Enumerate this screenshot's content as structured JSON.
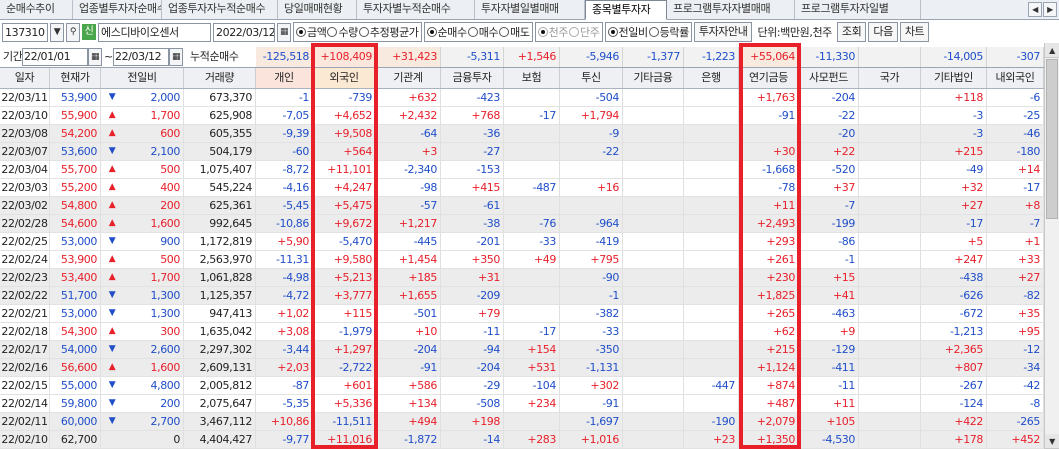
{
  "tabs": [
    {
      "label": "순매수추이"
    },
    {
      "label": "업종별투자자순매수"
    },
    {
      "label": "업종투자자누적순매수"
    },
    {
      "label": "당일매매현황"
    },
    {
      "label": "투자자별누적순매수"
    },
    {
      "label": "투자자별일별매매"
    },
    {
      "label": "종목별투자자"
    },
    {
      "label": "프로그램투자자별매매"
    },
    {
      "label": "프로그램투자자일별"
    }
  ],
  "active_tab": 6,
  "toolbar": {
    "code": "137310",
    "badge": "신",
    "stock_name": "에스디바이오센서",
    "date": "2022/03/12",
    "radio_value": [
      {
        "label": "금액",
        "on": true
      },
      {
        "label": "수량",
        "on": false
      },
      {
        "label": "추정평균가",
        "on": false
      }
    ],
    "radio_trade": [
      {
        "label": "순매수",
        "on": true
      },
      {
        "label": "매수",
        "on": false
      },
      {
        "label": "매도",
        "on": false
      }
    ],
    "radio_unit": [
      {
        "label": "천주",
        "on": true
      },
      {
        "label": "단주",
        "on": false
      }
    ],
    "radio_compare": [
      {
        "label": "전일비",
        "on": true
      },
      {
        "label": "등락률",
        "on": false
      }
    ],
    "info_button": "투자자안내",
    "unit_label": "단위:백만원,천주",
    "query_button": "조회",
    "next_button": "다음",
    "chart_button": "차트"
  },
  "period": {
    "label": "기간",
    "from": "22/01/01",
    "tilde": "~",
    "to": "22/03/12",
    "sum_label": "누적순매수",
    "sums": [
      "-125,518",
      "+108,409",
      "+31,423",
      "-5,311",
      "+1,546",
      "-5,946",
      "-1,377",
      "-1,223",
      "+55,064",
      "-11,330",
      "",
      "-14,005",
      "-307"
    ]
  },
  "columns": [
    "일자",
    "현재가",
    "전일비",
    "거래량",
    "개인",
    "외국인",
    "기관계",
    "금융투자",
    "보험",
    "투신",
    "기타금융",
    "은행",
    "연기금등",
    "사모펀드",
    "국가",
    "기타법인",
    "내외국인"
  ],
  "rows": [
    [
      "22/03/11",
      "53,900",
      "down",
      "2,000",
      "673,370",
      "-1",
      "-739",
      "+632",
      "-423",
      "",
      "-504",
      "",
      "",
      "+1,763",
      "-204",
      "",
      "+118",
      "-6"
    ],
    [
      "22/03/10",
      "55,900",
      "up",
      "1,700",
      "625,908",
      "-7,05",
      "+4,652",
      "+2,432",
      "+768",
      "-17",
      "+1,794",
      "",
      "",
      "-91",
      "-22",
      "",
      "-3",
      "-25"
    ],
    [
      "22/03/08",
      "54,200",
      "up",
      "600",
      "605,355",
      "-9,39",
      "+9,508",
      "-64",
      "-36",
      "",
      "-9",
      "",
      "",
      "",
      "-20",
      "",
      "-3",
      "-46"
    ],
    [
      "22/03/07",
      "53,600",
      "down",
      "2,100",
      "504,179",
      "-60",
      "+564",
      "+3",
      "-27",
      "",
      "-22",
      "",
      "",
      "+30",
      "+22",
      "",
      "+215",
      "-180"
    ],
    [
      "22/03/04",
      "55,700",
      "up",
      "500",
      "1,075,407",
      "-8,72",
      "+11,101",
      "-2,340",
      "-153",
      "",
      "",
      "",
      "",
      "-1,668",
      "-520",
      "",
      "-49",
      "+14"
    ],
    [
      "22/03/03",
      "55,200",
      "up",
      "400",
      "545,224",
      "-4,16",
      "+4,247",
      "-98",
      "+415",
      "-487",
      "+16",
      "",
      "",
      "-78",
      "+37",
      "",
      "+32",
      "-17"
    ],
    [
      "22/03/02",
      "54,800",
      "up",
      "200",
      "625,361",
      "-5,45",
      "+5,475",
      "-57",
      "-61",
      "",
      "",
      "",
      "",
      "+11",
      "-7",
      "",
      "+27",
      "+8"
    ],
    [
      "22/02/28",
      "54,600",
      "up",
      "1,600",
      "992,645",
      "-10,86",
      "+9,672",
      "+1,217",
      "-38",
      "-76",
      "-964",
      "",
      "",
      "+2,493",
      "-199",
      "",
      "-17",
      "-7"
    ],
    [
      "22/02/25",
      "53,000",
      "down",
      "900",
      "1,172,819",
      "+5,90",
      "-5,470",
      "-445",
      "-201",
      "-33",
      "-419",
      "",
      "",
      "+293",
      "-86",
      "",
      "+5",
      "+1"
    ],
    [
      "22/02/24",
      "53,900",
      "up",
      "500",
      "2,563,970",
      "-11,31",
      "+9,580",
      "+1,454",
      "+350",
      "+49",
      "+795",
      "",
      "",
      "+261",
      "-1",
      "",
      "+247",
      "+33"
    ],
    [
      "22/02/23",
      "53,400",
      "up",
      "1,700",
      "1,061,828",
      "-4,98",
      "+5,213",
      "+185",
      "+31",
      "",
      "-90",
      "",
      "",
      "+230",
      "+15",
      "",
      "-438",
      "+27"
    ],
    [
      "22/02/22",
      "51,700",
      "down",
      "1,300",
      "1,125,357",
      "-4,72",
      "+3,777",
      "+1,655",
      "-209",
      "",
      "-1",
      "",
      "",
      "+1,825",
      "+41",
      "",
      "-626",
      "-82"
    ],
    [
      "22/02/21",
      "53,000",
      "down",
      "1,300",
      "947,413",
      "+1,02",
      "+115",
      "-501",
      "+79",
      "",
      "-382",
      "",
      "",
      "+265",
      "-463",
      "",
      "-672",
      "+35"
    ],
    [
      "22/02/18",
      "54,300",
      "up",
      "300",
      "1,635,042",
      "+3,08",
      "-1,979",
      "+10",
      "-11",
      "-17",
      "-33",
      "",
      "",
      "+62",
      "+9",
      "",
      "-1,213",
      "+95"
    ],
    [
      "22/02/17",
      "54,000",
      "down",
      "2,600",
      "2,297,302",
      "-3,44",
      "+1,297",
      "-204",
      "-94",
      "+154",
      "-350",
      "",
      "",
      "+215",
      "-129",
      "",
      "+2,365",
      "-12"
    ],
    [
      "22/02/16",
      "56,600",
      "up",
      "1,600",
      "2,609,131",
      "+2,03",
      "-2,722",
      "-91",
      "-204",
      "+531",
      "-1,131",
      "",
      "",
      "+1,124",
      "-411",
      "",
      "+807",
      "-34"
    ],
    [
      "22/02/15",
      "55,000",
      "down",
      "4,800",
      "2,005,812",
      "-87",
      "+601",
      "+586",
      "-29",
      "-104",
      "+302",
      "",
      "-447",
      "+874",
      "-11",
      "",
      "-267",
      "-42"
    ],
    [
      "22/02/14",
      "59,800",
      "down",
      "200",
      "2,075,647",
      "-5,35",
      "+5,336",
      "+134",
      "-508",
      "+234",
      "-91",
      "",
      "",
      "+487",
      "+11",
      "",
      "-124",
      "-8"
    ],
    [
      "22/02/11",
      "60,000",
      "down",
      "2,700",
      "3,467,112",
      "+10,86",
      "-11,511",
      "+494",
      "+198",
      "",
      "-1,697",
      "",
      "-190",
      "+2,079",
      "+105",
      "",
      "+422",
      "-265"
    ],
    [
      "22/02/10",
      "62,700",
      "none",
      "0",
      "4,404,427",
      "-9,77",
      "+11,016",
      "-1,872",
      "-14",
      "+283",
      "+1,016",
      "",
      "+23",
      "+1,350",
      "-4,530",
      "",
      "+178",
      "+452"
    ]
  ],
  "colors": {
    "up": "#e8202a",
    "down": "#1f4ec8",
    "highlight": "#e8202a",
    "shin_badge": "#4aa64a",
    "active_tab_bg": "#ffffff"
  }
}
